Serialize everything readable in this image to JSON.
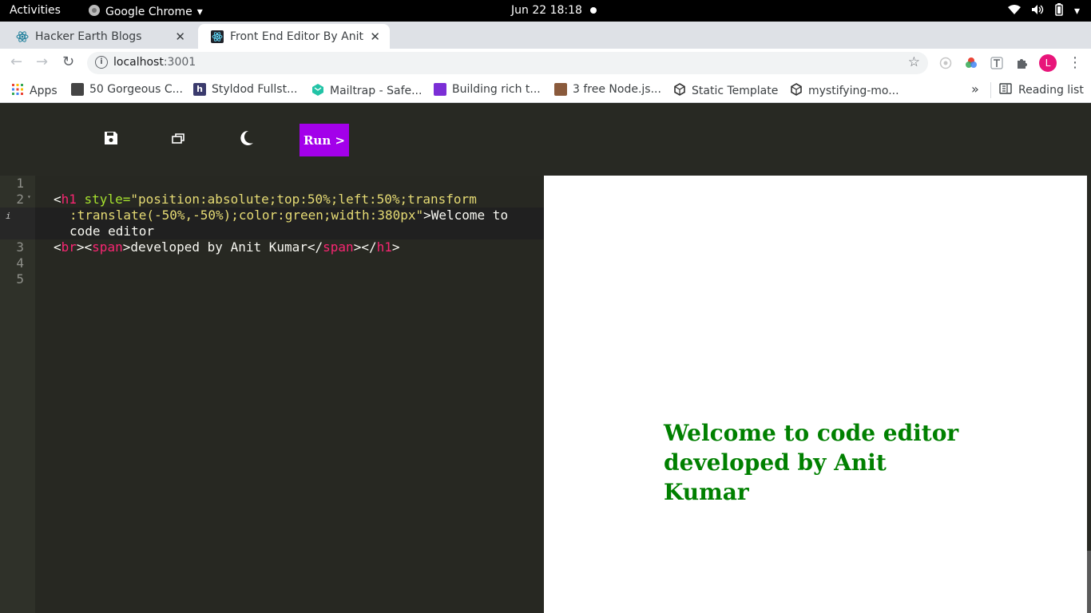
{
  "system_bar": {
    "activities": "Activities",
    "app_name": "Google Chrome",
    "clock": "Jun 22  18:18"
  },
  "tabs": [
    {
      "title": "Hacker Earth Blogs",
      "active": false
    },
    {
      "title": "Front End Editor By Anit Kumar",
      "active": true
    }
  ],
  "address": {
    "host": "localhost",
    "port": ":3001"
  },
  "profile_initial": "L",
  "bookmarks": [
    {
      "label": "Apps",
      "icon": "apps-grid-icon",
      "color": "#ea4335"
    },
    {
      "label": "50 Gorgeous C...",
      "icon": "site-icon",
      "color": "#444444"
    },
    {
      "label": "Styldod Fullst...",
      "icon": "h-logo-icon",
      "color": "#3b3b6d"
    },
    {
      "label": "Mailtrap - Safe...",
      "icon": "mailtrap-icon",
      "color": "#22c3a6"
    },
    {
      "label": "Building rich t...",
      "icon": "rocket-icon",
      "color": "#7b2ed6"
    },
    {
      "label": "3 free Node.js...",
      "icon": "avatar-icon",
      "color": "#8a5a3c"
    },
    {
      "label": "Static Template",
      "icon": "codesandbox-icon",
      "color": "#333333"
    },
    {
      "label": "mystifying-mo...",
      "icon": "codesandbox-icon",
      "color": "#333333"
    }
  ],
  "reading_list": "Reading list",
  "editor_toolbar": {
    "run_label": "Run >"
  },
  "editor": {
    "line_numbers": [
      "1",
      "2",
      "3",
      "4",
      "5"
    ],
    "line2_part1_open": "<",
    "line2_tag": "h1",
    "line2_attr": " style=",
    "line2_str_a": "\"position:absolute;top:50%;left:50%;transform",
    "line2_str_b": ":translate(-50%,-50%);color:green;width:380px\"",
    "line2_text_a": ">Welcome to",
    "line2_text_b": "code editor",
    "line3_a": "<",
    "line3_br": "br",
    "line3_b": "><",
    "line3_span": "span",
    "line3_c": ">developed by Anit Kumar</",
    "line3_span2": "span",
    "line3_d": "></",
    "line3_h1": "h1",
    "line3_e": ">"
  },
  "preview": {
    "heading_line1": "Welcome to code editor",
    "heading_line2": "developed by Anit Kumar"
  },
  "colors": {
    "run_button": "#a300ea",
    "editor_bg": "#272822",
    "preview_text": "#008000"
  }
}
